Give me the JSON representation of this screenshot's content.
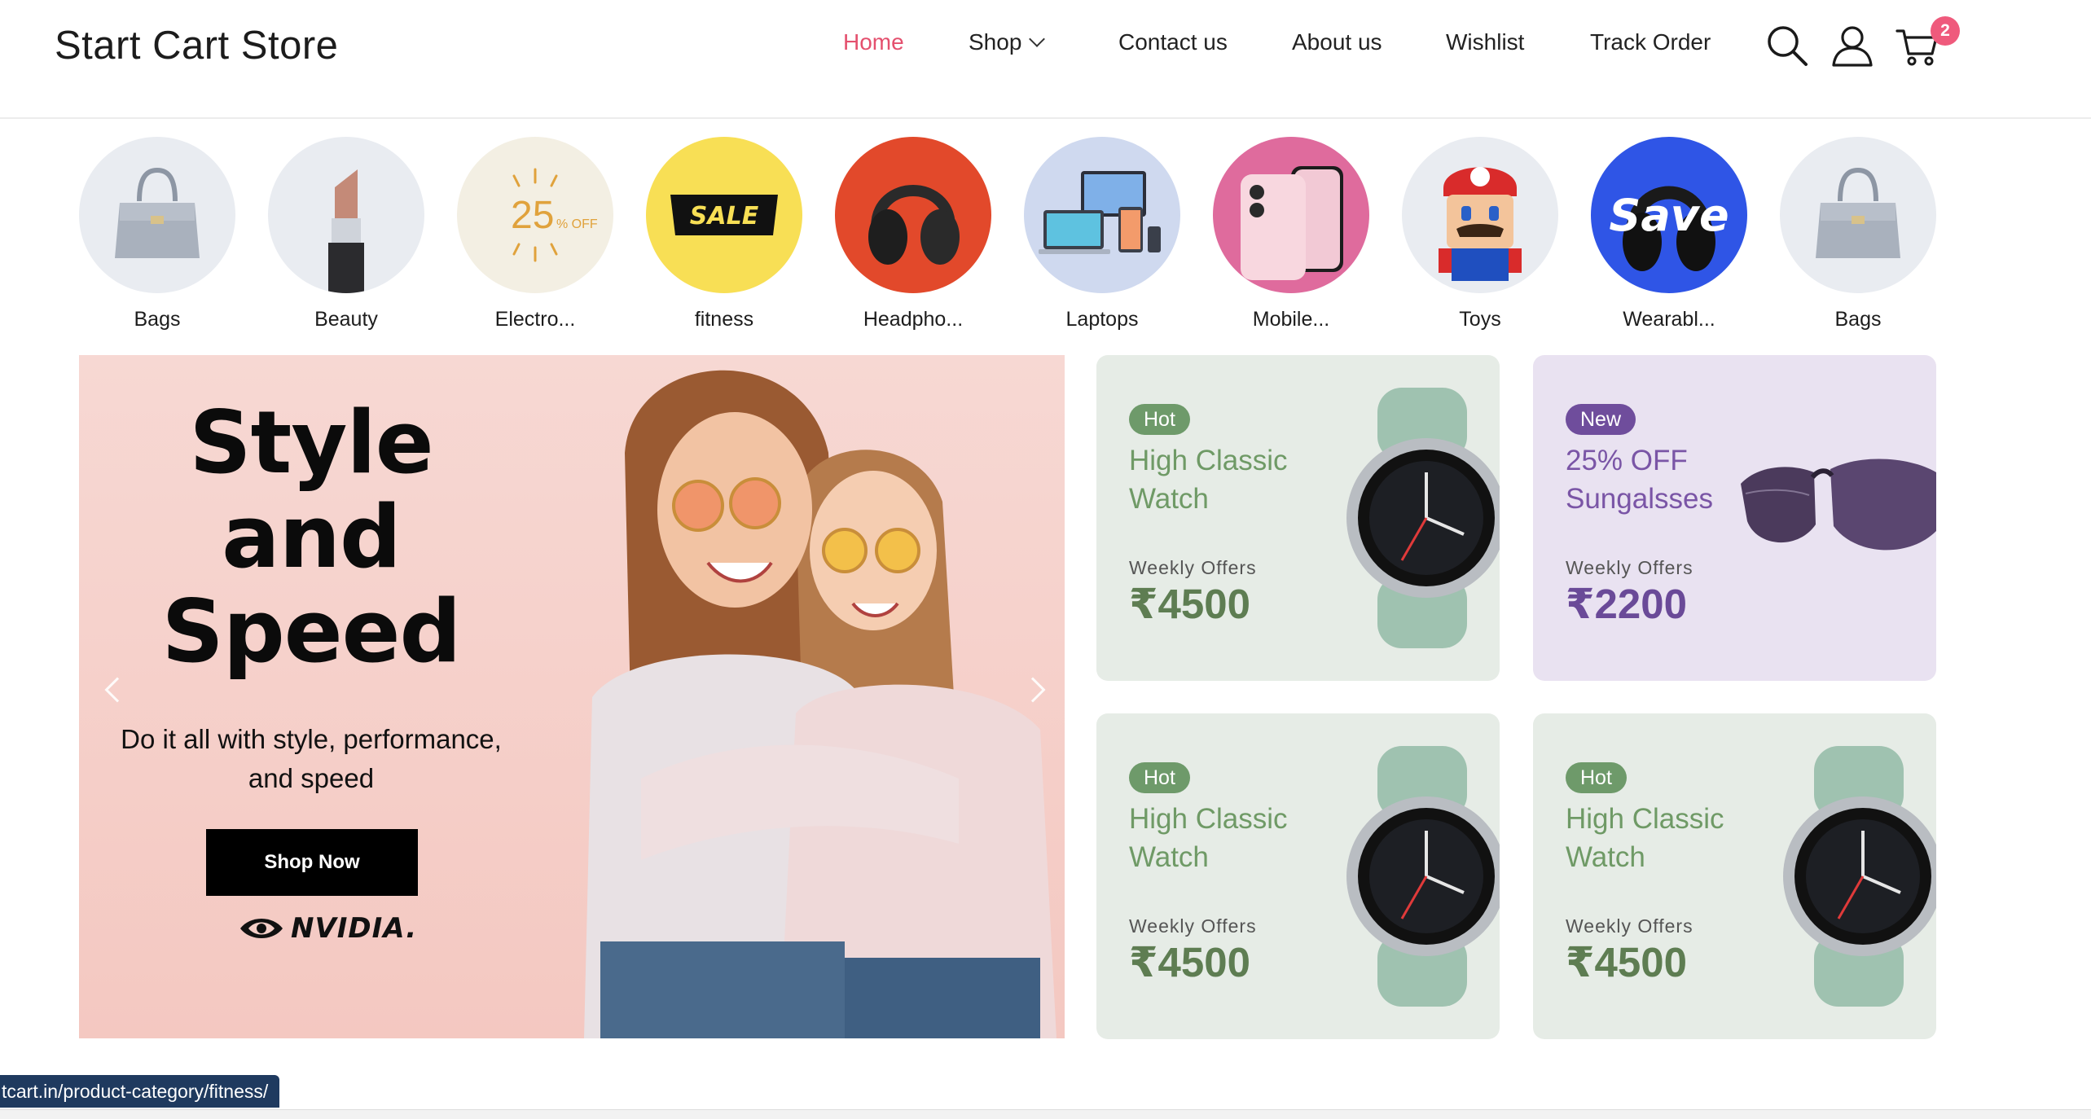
{
  "header": {
    "brand": "Start Cart Store",
    "nav": [
      {
        "label": "Home",
        "active": true
      },
      {
        "label": "Shop",
        "dropdown": true
      },
      {
        "label": "Contact us"
      },
      {
        "label": "About us"
      },
      {
        "label": "Wishlist"
      },
      {
        "label": "Track Order"
      }
    ],
    "icons": [
      "search-icon",
      "user-icon",
      "cart-icon"
    ],
    "cart_count": "2",
    "accent_color": "#e4506e"
  },
  "categories": [
    {
      "label": "Bags",
      "icon": "handbag",
      "bg": "#e9ecf1"
    },
    {
      "label": "Beauty",
      "icon": "lipstick",
      "bg": "#e9ecf1"
    },
    {
      "label": "Electro...",
      "icon": "discount-25",
      "bg": "#f3efe3",
      "art_text": "25",
      "art_text_small": "% OFF"
    },
    {
      "label": "fitness",
      "icon": "sale-tag",
      "bg": "#f8df55",
      "art_text": "SALE"
    },
    {
      "label": "Headpho...",
      "icon": "headphones",
      "bg": "#e2492b"
    },
    {
      "label": "Laptops",
      "icon": "devices",
      "bg": "#cfd9ef"
    },
    {
      "label": "Mobile...",
      "icon": "smartphone",
      "bg": "#df6b9d"
    },
    {
      "label": "Toys",
      "icon": "toy-figure",
      "bg": "#e9ecf1"
    },
    {
      "label": "Wearabl...",
      "icon": "save-headphones",
      "bg": "#2f55e6",
      "art_text": "Save"
    },
    {
      "label": "Bags",
      "icon": "handbag",
      "bg": "#e9ecf1"
    }
  ],
  "hero": {
    "title_lines": [
      "Style",
      "and",
      "Speed"
    ],
    "subtitle": "Do it all with style, performance, and speed",
    "button": "Shop Now",
    "logo_text": "NVIDIA."
  },
  "promos": [
    {
      "badge": "Hot",
      "title": "High Classic Watch",
      "subtitle": "Weekly Offers",
      "price": "₹4500",
      "theme": "green",
      "product": "smartwatch"
    },
    {
      "badge": "New",
      "title": "25% OFF Sungalsses",
      "subtitle": "Weekly Offers",
      "price": "₹2200",
      "theme": "purple",
      "product": "sunglasses"
    },
    {
      "badge": "Hot",
      "title": "High Classic Watch",
      "subtitle": "Weekly Offers",
      "price": "₹4500",
      "theme": "green",
      "product": "smartwatch"
    },
    {
      "badge": "Hot",
      "title": "High Classic Watch",
      "subtitle": "Weekly Offers",
      "price": "₹4500",
      "theme": "green",
      "product": "smartwatch"
    }
  ],
  "status_url": "tcart.in/product-category/fitness/"
}
